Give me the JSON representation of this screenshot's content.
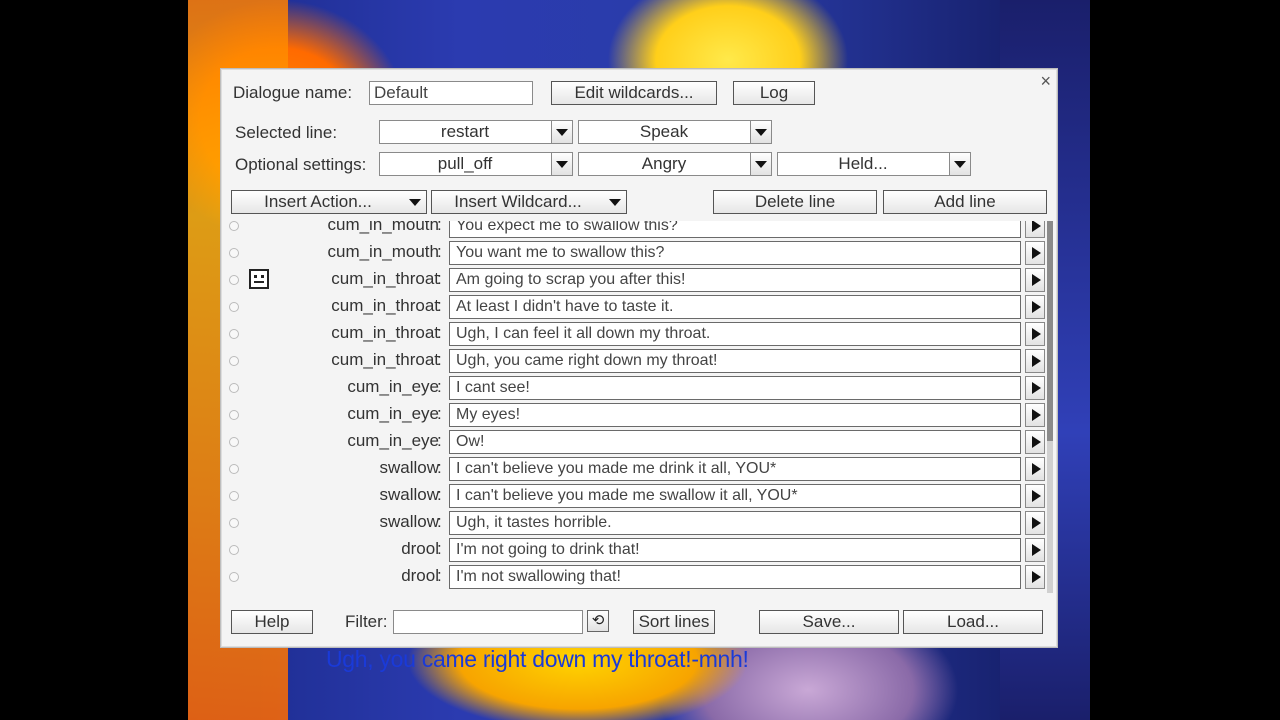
{
  "subtitle": "Ugh, you came right down my throat!-mnh!",
  "header": {
    "dialogue_name_label": "Dialogue name:",
    "dialogue_name_value": "Default",
    "edit_wildcards": "Edit wildcards...",
    "log": "Log",
    "close": "×"
  },
  "selected_line": {
    "label": "Selected line:",
    "trigger": "restart",
    "action": "Speak"
  },
  "optional_settings": {
    "label": "Optional settings:",
    "position": "pull_off",
    "mood": "Angry",
    "held": "Held..."
  },
  "toolbar": {
    "insert_action": "Insert Action...",
    "insert_wildcard": "Insert Wildcard...",
    "delete_line": "Delete line",
    "add_line": "Add line"
  },
  "lines": [
    {
      "tag": "cum_in_mouth",
      "text": "You expect me to swallow this?",
      "icon": ""
    },
    {
      "tag": "cum_in_mouth",
      "text": "You want me to swallow this?",
      "icon": ""
    },
    {
      "tag": "cum_in_throat",
      "text": "Am going to scrap you after this!",
      "icon": "angry-face-icon"
    },
    {
      "tag": "cum_in_throat",
      "text": "At least I didn't have to taste it.",
      "icon": ""
    },
    {
      "tag": "cum_in_throat",
      "text": "Ugh, I can feel it all down my throat.",
      "icon": ""
    },
    {
      "tag": "cum_in_throat",
      "text": "Ugh, you came right down my throat!",
      "icon": ""
    },
    {
      "tag": "cum_in_eye",
      "text": "I cant see!",
      "icon": ""
    },
    {
      "tag": "cum_in_eye",
      "text": "My eyes!",
      "icon": ""
    },
    {
      "tag": "cum_in_eye",
      "text": "Ow!",
      "icon": ""
    },
    {
      "tag": "swallow",
      "text": "I can't believe you made me drink it all, YOU*",
      "icon": ""
    },
    {
      "tag": "swallow",
      "text": "I can't believe you made me swallow it all, YOU*",
      "icon": ""
    },
    {
      "tag": "swallow",
      "text": "Ugh, it tastes horrible.",
      "icon": ""
    },
    {
      "tag": "drool",
      "text": "I'm not going to drink that!",
      "icon": ""
    },
    {
      "tag": "drool",
      "text": "I'm not swallowing that!",
      "icon": ""
    }
  ],
  "footer": {
    "help": "Help",
    "filter_label": "Filter:",
    "filter_value": "",
    "sort_lines": "Sort lines",
    "save": "Save...",
    "load": "Load..."
  }
}
